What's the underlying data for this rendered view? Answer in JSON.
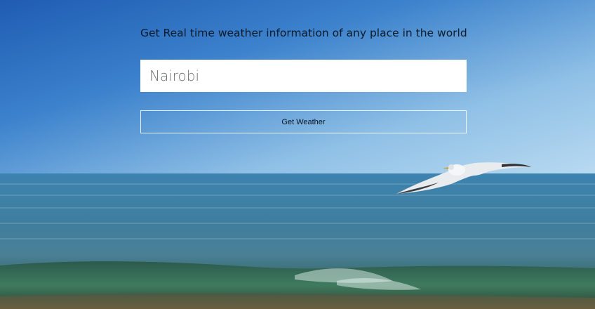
{
  "page": {
    "headline": "Get Real time weather information of any place in the world"
  },
  "search": {
    "value": "Nairobi",
    "button_label": "Get Weather"
  },
  "background": {
    "scene": "seagull-over-ocean",
    "sky_color": "#2f78c8",
    "sea_color": "#3d7fa6"
  }
}
